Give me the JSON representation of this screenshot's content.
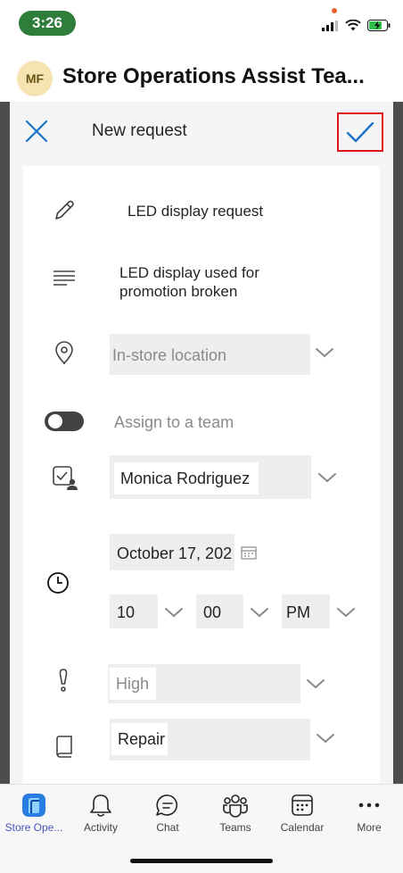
{
  "status_bar": {
    "time": "3:26"
  },
  "team_header": {
    "avatar_initials": "MF",
    "title": "Store Operations Assist Tea..."
  },
  "request_header": {
    "title": "New request"
  },
  "form": {
    "title_value": "LED display request",
    "description_line1": "LED display used for",
    "description_line2": "promotion broken",
    "location_placeholder": "In-store location",
    "assign_team_label": "Assign to a team",
    "assignee": "Monica Rodriguez",
    "date": "October 17, 202",
    "hour": "10",
    "minute": "00",
    "ampm": "PM",
    "priority": "High",
    "category": "Repair"
  },
  "bottom_nav": {
    "items": [
      {
        "label": "Store Ope...",
        "icon": "store-app-icon",
        "active": true
      },
      {
        "label": "Activity",
        "icon": "bell-icon"
      },
      {
        "label": "Chat",
        "icon": "chat-icon"
      },
      {
        "label": "Teams",
        "icon": "teams-icon"
      },
      {
        "label": "Calendar",
        "icon": "calendar-icon"
      },
      {
        "label": "More",
        "icon": "more-icon"
      }
    ]
  },
  "colors": {
    "accent": "#1a73c7",
    "highlight_box": "#e2141c",
    "status_pill": "#2f7d3b",
    "frame": "#4d4d4d"
  }
}
